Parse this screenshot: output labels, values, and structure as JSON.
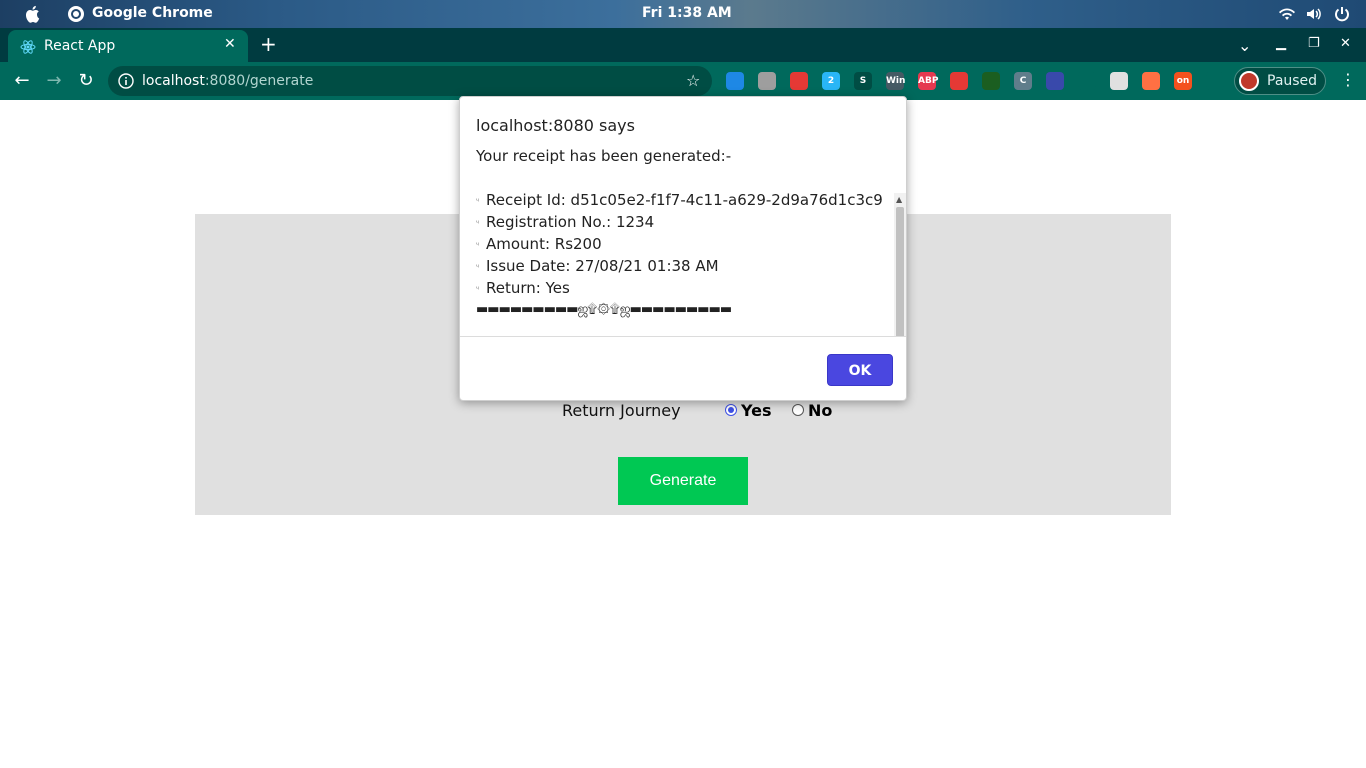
{
  "os": {
    "app_name": "Google Chrome",
    "clock": "Fri  1:38 AM"
  },
  "browser": {
    "tab_title": "React App",
    "url_host": "localhost",
    "url_rest": ":8080/generate",
    "profile_label": "Paused",
    "extensions": [
      {
        "name": "link-extension-icon",
        "color": "#1e88e5",
        "text": ""
      },
      {
        "name": "shield-extension-icon",
        "color": "#9e9e9e",
        "text": ""
      },
      {
        "name": "hand-stop-extension-icon",
        "color": "#e53935",
        "text": ""
      },
      {
        "name": "translate-extension-icon",
        "color": "#29b6f6",
        "text": "2"
      },
      {
        "name": "s-extension-icon",
        "color": "#004d44",
        "text": "S"
      },
      {
        "name": "win-extension-icon",
        "color": "#455a64",
        "text": "Win"
      },
      {
        "name": "abp-extension-icon",
        "color": "#e53950",
        "text": "ABP"
      },
      {
        "name": "youtube-extension-icon",
        "color": "#e53935",
        "text": ""
      },
      {
        "name": "robot-extension-icon",
        "color": "#1b5e20",
        "text": ""
      },
      {
        "name": "c-extension-icon",
        "color": "#607d8b",
        "text": "C"
      },
      {
        "name": "screenshot-extension-icon",
        "color": "#3949ab",
        "text": ""
      },
      {
        "name": "download-extension-icon",
        "color": "#00695c",
        "text": ""
      },
      {
        "name": "window-extension-icon",
        "color": "#e0e0e0",
        "text": ""
      },
      {
        "name": "flame-extension-icon",
        "color": "#ff7043",
        "text": ""
      },
      {
        "name": "pdf-extension-icon",
        "color": "#f4511e",
        "text": "on"
      },
      {
        "name": "puzzle-extensions-icon",
        "color": "#00695c",
        "text": ""
      }
    ]
  },
  "dialog": {
    "title": "localhost:8080 says",
    "heading": "Your receipt has been generated:-",
    "lines": [
      "Receipt Id: d51c05e2-f1f7-4c11-a629-2d9a76d1c3c9",
      "Registration No.: 1234",
      "Amount: Rs200",
      "Issue Date: 27/08/21 01:38 AM",
      "Return: Yes"
    ],
    "divider": "▬▬▬▬▬▬▬▬▬ஜ۩۞۩ஜ▬▬▬▬▬▬▬▬▬",
    "ok_label": "OK"
  },
  "form": {
    "return_label": "Return Journey",
    "option_yes": "Yes",
    "option_no": "No",
    "selected": "Yes",
    "generate_label": "Generate"
  }
}
